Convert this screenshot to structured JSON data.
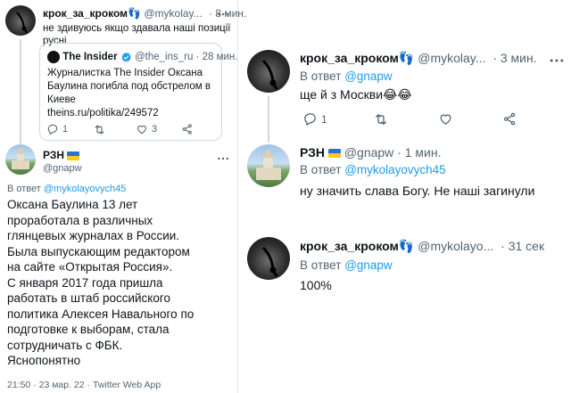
{
  "left": {
    "tweet1": {
      "name": "крок_за_кроком👣",
      "handle": "@mykolay...",
      "time": "· 8 мин.",
      "text_line1": "не здивуюсь якщо здавала наші позиції",
      "text_line2": "русні",
      "quote": {
        "name": "The Insider",
        "handle": "@the_ins_ru",
        "time": "· 28 мин.",
        "line1": "Журналистка The Insider Оксана",
        "line2": "Баулина погибла под обстрелом в",
        "line3": "Киеве",
        "link": "theins.ru/politika/249572"
      },
      "replies": "1",
      "likes": "3"
    },
    "tweet2": {
      "name": "РЗН",
      "handle": "@gnapw",
      "reply_prefix": "В ответ",
      "reply_to": "@mykolayovych45",
      "lines": [
        "Оксана Баулина 13 лет",
        "проработала в различных",
        "глянцевых журналах в России.",
        "Была выпускающим редактором",
        "на сайте «Открытая Россия».",
        "С января 2017 года пришла",
        "работать в штаб российского",
        "политика Алексея Навального по",
        "подготовке к выборам, стала",
        "сотрудничать с ФБК.",
        "Яснопонятно"
      ],
      "meta": "21:50 · 23 мар. 22 · Twitter Web App"
    }
  },
  "right": {
    "tweet1": {
      "name": "крок_за_кроком👣",
      "handle": "@mykolay...",
      "time": "· 3 мин.",
      "reply_prefix": "В ответ",
      "reply_to": "@gnapw",
      "text": "ще й з Москви😂😂",
      "replies": "1"
    },
    "tweet2": {
      "name": "РЗН",
      "handle": "@gnapw",
      "time": "· 1 мин.",
      "reply_prefix": "В ответ",
      "reply_to": "@mykolayovych45",
      "text": "ну значить слава Богу. Не наші загинули"
    },
    "tweet3": {
      "name": "крок_за_кроком👣",
      "handle": "@mykolayo...",
      "time": "· 31 сек",
      "reply_prefix": "В ответ",
      "reply_to": "@gnapw",
      "text": "100%"
    }
  },
  "icons": {
    "more": "more-dots-icon",
    "reply": "reply-icon",
    "retweet": "retweet-icon",
    "like": "like-icon",
    "share": "share-icon",
    "verified": "verified-badge-icon"
  },
  "colors": {
    "link": "#1d9bf0",
    "muted": "#536471",
    "text": "#0f1419"
  }
}
